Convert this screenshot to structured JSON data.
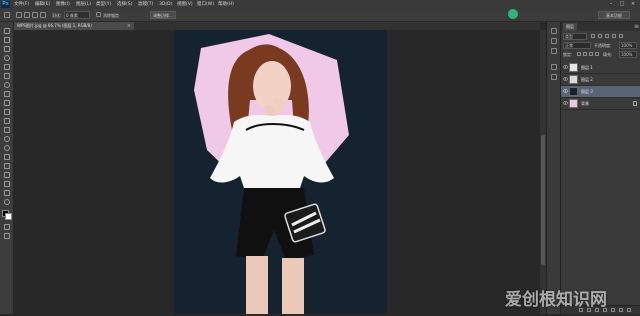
{
  "app": {
    "logo_text": "Ps",
    "menu": [
      "文件(F)",
      "编辑(E)",
      "图像(I)",
      "图层(L)",
      "类型(Y)",
      "选择(S)",
      "滤镜(T)",
      "3D(D)",
      "视图(V)",
      "窗口(W)",
      "帮助(H)"
    ],
    "window_controls": [
      "–",
      "□",
      "×"
    ]
  },
  "options_bar": {
    "feather_label": "羽化:",
    "feather_value": "0 像素",
    "antialias_label": "消除锯齿",
    "refine_edge_button": "调整边缘...",
    "workspace": "基本功能"
  },
  "document": {
    "tab_title": "WPS图片.jpg @ 66.7% (图层 1, RGB/8)",
    "tab_close": "×"
  },
  "layers_panel": {
    "tab_label": "图层",
    "menu_icon": "≡",
    "filter_kind": "类型",
    "blend_mode": "正常",
    "opacity_label": "不透明度:",
    "opacity_value": "100%",
    "lock_label": "锁定:",
    "fill_label": "填充:",
    "fill_value": "100%",
    "layers": [
      {
        "name": "图层 1",
        "visible": true,
        "selected": false,
        "thumb_color": "#e6e6e6"
      },
      {
        "name": "图层 2",
        "visible": true,
        "selected": false,
        "thumb_color": "#d8d8d8"
      },
      {
        "name": "图层 3",
        "visible": true,
        "selected": true,
        "thumb_color": "#152331"
      },
      {
        "name": "背景",
        "visible": true,
        "selected": false,
        "thumb_color": "#e9c9dd",
        "locked": true
      }
    ]
  },
  "watermark": "爱创根知识网",
  "colors": {
    "doc_background": "#152331",
    "pink_shape": "#f0c9e8",
    "selected_layer": "#596477"
  }
}
